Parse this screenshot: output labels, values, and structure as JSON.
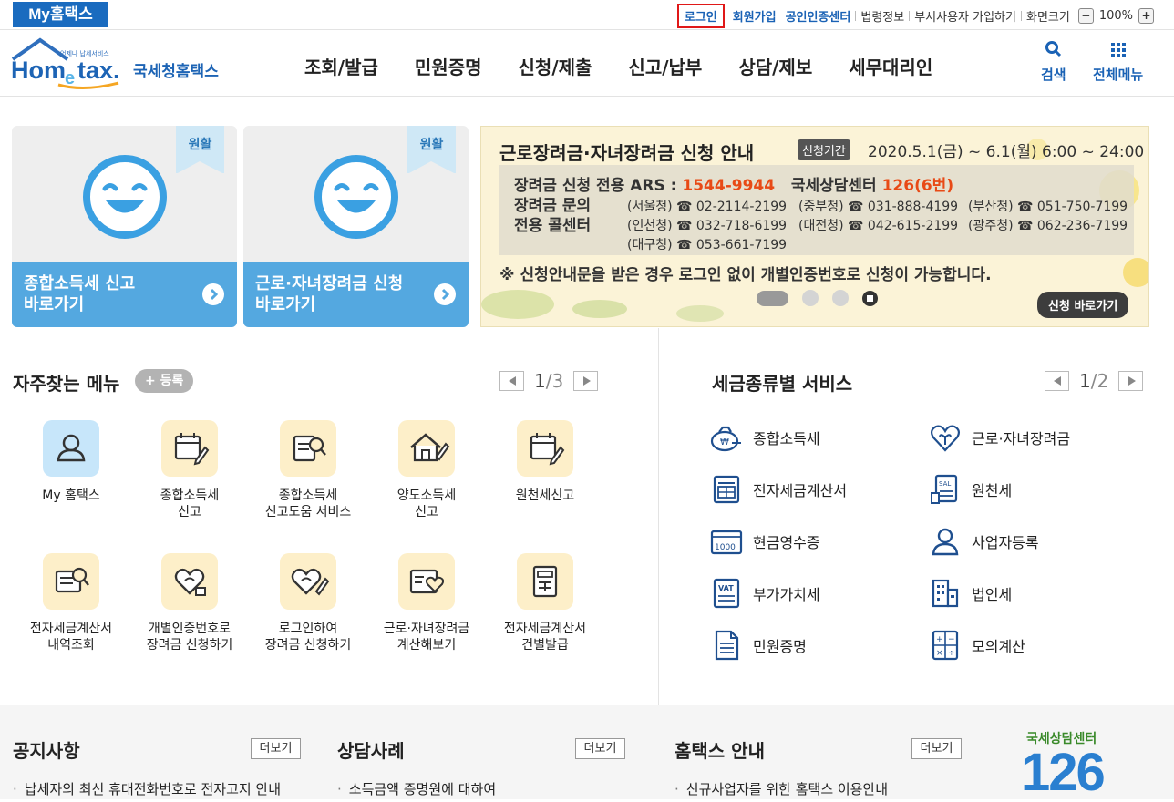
{
  "topbar": {
    "my_hometax": "My홈택스",
    "login": "로그인",
    "signup": "회원가입",
    "cert_center": "공인인증센터",
    "law_info": "법령정보",
    "dept_user_signup": "부서사용자 가입하기",
    "screen_size": "화면크기",
    "zoom_minus": "−",
    "zoom_value": "100%",
    "zoom_plus": "+"
  },
  "header": {
    "logo_small": "언제나 납세서비스",
    "logo_main": "Hometax",
    "logo_sub": "국세청홈택스",
    "nav": [
      "조회/발급",
      "민원증명",
      "신청/제출",
      "신고/납부",
      "상담/제보",
      "세무대리인"
    ],
    "search_label": "검색",
    "all_menu_label": "전체메뉴"
  },
  "cards": [
    {
      "badge": "원활",
      "title_line1": "종합소득세 신고",
      "title_line2": "바로가기"
    },
    {
      "badge": "원활",
      "title_line1": "근로·자녀장려금 신청",
      "title_line2": "바로가기"
    }
  ],
  "banner": {
    "title": "근로장려금·자녀장려금 신청 안내",
    "period_tag": "신청기간",
    "period": "2020.5.1(금) ~ 6.1(월) 6:00 ~ 24:00",
    "ars_label": "장려금 신청 전용 ARS :",
    "ars_number": "1544-9944",
    "center_label": "국세상담센터",
    "center_number": "126(6번)",
    "inquiry_line1": "장려금 문의",
    "inquiry_line2": "전용 콜센터",
    "phones": [
      "(서울청) ☎ 02-2114-2199",
      "(중부청) ☎ 031-888-4199",
      "(부산청) ☎ 051-750-7199",
      "(인천청) ☎ 032-718-6199",
      "(대전청) ☎ 042-615-2199",
      "(광주청) ☎ 062-236-7199",
      "(대구청) ☎ 053-661-7199"
    ],
    "note": "※ 신청안내문을 받은 경우 로그인 없이 개별인증번호로 신청이 가능합니다.",
    "go_button": "신청 바로가기"
  },
  "favorites": {
    "title": "자주찾는 메뉴",
    "register": "+ 등록",
    "page_current": "1",
    "page_total": "/3",
    "items": [
      {
        "line1": "My 홈택스",
        "line2": "",
        "icon": "user-icon"
      },
      {
        "line1": "종합소득세",
        "line2": "신고",
        "icon": "calendar-pen-icon"
      },
      {
        "line1": "종합소득세",
        "line2": "신고도움 서비스",
        "icon": "document-search-icon"
      },
      {
        "line1": "양도소득세",
        "line2": "신고",
        "icon": "house-pen-icon"
      },
      {
        "line1": "원천세신고",
        "line2": "",
        "icon": "calendar-pen-icon"
      },
      {
        "line1": "전자세금계산서",
        "line2": "내역조회",
        "icon": "invoice-search-icon"
      },
      {
        "line1": "개별인증번호로",
        "line2": "장려금 신청하기",
        "icon": "heart-hand-icon"
      },
      {
        "line1": "로그인하여",
        "line2": "장려금 신청하기",
        "icon": "heart-pen-icon"
      },
      {
        "line1": "근로·자녀장려금",
        "line2": "계산해보기",
        "icon": "card-heart-icon"
      },
      {
        "line1": "전자세금계산서",
        "line2": "건별발급",
        "icon": "calculator-doc-icon"
      }
    ]
  },
  "tax_services": {
    "title": "세금종류별 서비스",
    "page_current": "1",
    "page_total": "/2",
    "items": [
      {
        "label": "종합소득세",
        "icon": "money-bag-icon"
      },
      {
        "label": "근로·자녀장려금",
        "icon": "heart-plant-icon"
      },
      {
        "label": "전자세금계산서",
        "icon": "invoice-icon"
      },
      {
        "label": "원천세",
        "icon": "salary-doc-icon"
      },
      {
        "label": "현금영수증",
        "icon": "cash-receipt-icon"
      },
      {
        "label": "사업자등록",
        "icon": "user-outline-icon"
      },
      {
        "label": "부가가치세",
        "icon": "vat-doc-icon"
      },
      {
        "label": "법인세",
        "icon": "building-icon"
      },
      {
        "label": "민원증명",
        "icon": "document-icon"
      },
      {
        "label": "모의계산",
        "icon": "calculator-icon"
      }
    ]
  },
  "bottom": {
    "notice_title": "공지사항",
    "consult_title": "상담사례",
    "guide_title": "홈택스 안내",
    "more": "더보기",
    "notice_item": "납세자의 최신 휴대전화번호로 전자고지 안내",
    "consult_item": "소득금액 증명원에 대하여",
    "guide_item": "신규사업자를 위한 홈택스 이용안내",
    "center_top": "국세상담센터",
    "center_num": "126"
  },
  "colors": {
    "brand_blue": "#1a62b5",
    "accent_sky": "#54a8e0",
    "highlight_red": "#e84a16"
  }
}
